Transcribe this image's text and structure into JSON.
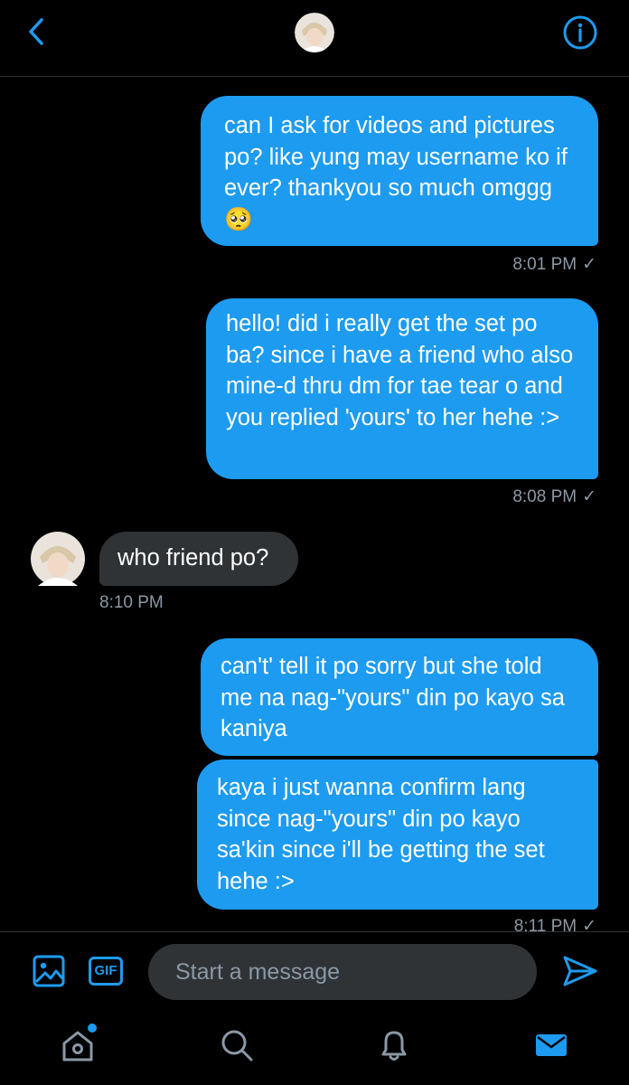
{
  "header": {
    "back_label": "Back",
    "info_label": "Info"
  },
  "messages": [
    {
      "text": "can I ask for videos and pictures po? like yung may username ko if ever? thankyou so much omggg 🥺",
      "time": "8:01 PM"
    },
    {
      "text": "hello! did i really get the set po ba? since i have a friend who also mine-d thru dm for tae tear o and you replied 'yours' to her hehe :>",
      "time": "8:08 PM"
    },
    {
      "text": "who friend po?",
      "time": "8:10 PM"
    },
    {
      "text": "can't' tell it po sorry but she told me na nag-\"yours\" din po kayo sa kaniya"
    },
    {
      "text": "kaya i just wanna confirm lang since nag-\"yours\" din po kayo sa'kin since i'll be getting the set hehe :>",
      "time": "8:11 PM"
    }
  ],
  "composer": {
    "placeholder": "Start a message",
    "gif_label": "GIF"
  },
  "colors": {
    "accent": "#1d9bf0",
    "incoming": "#2f3336",
    "background": "#000000",
    "muted": "#8b98a5"
  },
  "icons": [
    "chevron-left-icon",
    "info-icon",
    "image-icon",
    "gif-icon",
    "send-icon",
    "home-icon",
    "search-icon",
    "bell-icon",
    "mail-icon"
  ]
}
